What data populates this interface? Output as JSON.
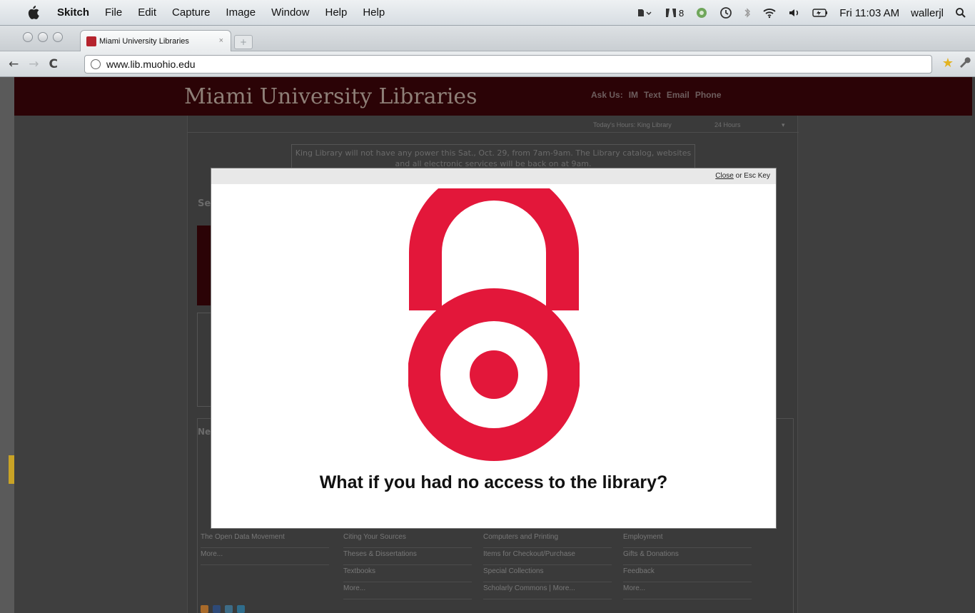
{
  "menubar": {
    "app_name": "Skitch",
    "items": [
      "File",
      "Edit",
      "Capture",
      "Image",
      "Window",
      "Help",
      "Help"
    ],
    "tray_text": "8",
    "clock": "Fri 11:03 AM",
    "user": "wallerjl"
  },
  "browser": {
    "tab_title": "Miami University Libraries",
    "url": "www.lib.muohio.edu"
  },
  "site": {
    "title": "Miami University Libraries",
    "ask_us": "Ask Us:",
    "im": "IM",
    "text": "Text",
    "email": "Email",
    "phone": "Phone",
    "hours_label": "Today's Hours: King Library",
    "hours_value": "24 Hours",
    "notice": "King Library will not have any power this Sat., Oct. 29, from 7am-9am. The Library catalog, websites and all electronic services will be back on at 9am.",
    "se_fragment": "Se",
    "ne_fragment": "Ne"
  },
  "footer_links": {
    "col1": [
      "The Open Data Movement",
      "More..."
    ],
    "col2": [
      "Citing Your Sources",
      "Theses & Dissertations",
      "Textbooks",
      "More..."
    ],
    "col3": [
      "Computers and Printing",
      "Items for Checkout/Purchase",
      "Special Collections",
      "Scholarly Commons | More..."
    ],
    "col4": [
      "Employment",
      "Gifts & Donations",
      "Feedback",
      "More..."
    ]
  },
  "modal": {
    "close_label": "Close",
    "close_suffix": "or Esc Key",
    "headline": "What if you had no access to the library?",
    "lock_color": "#e3173a"
  }
}
